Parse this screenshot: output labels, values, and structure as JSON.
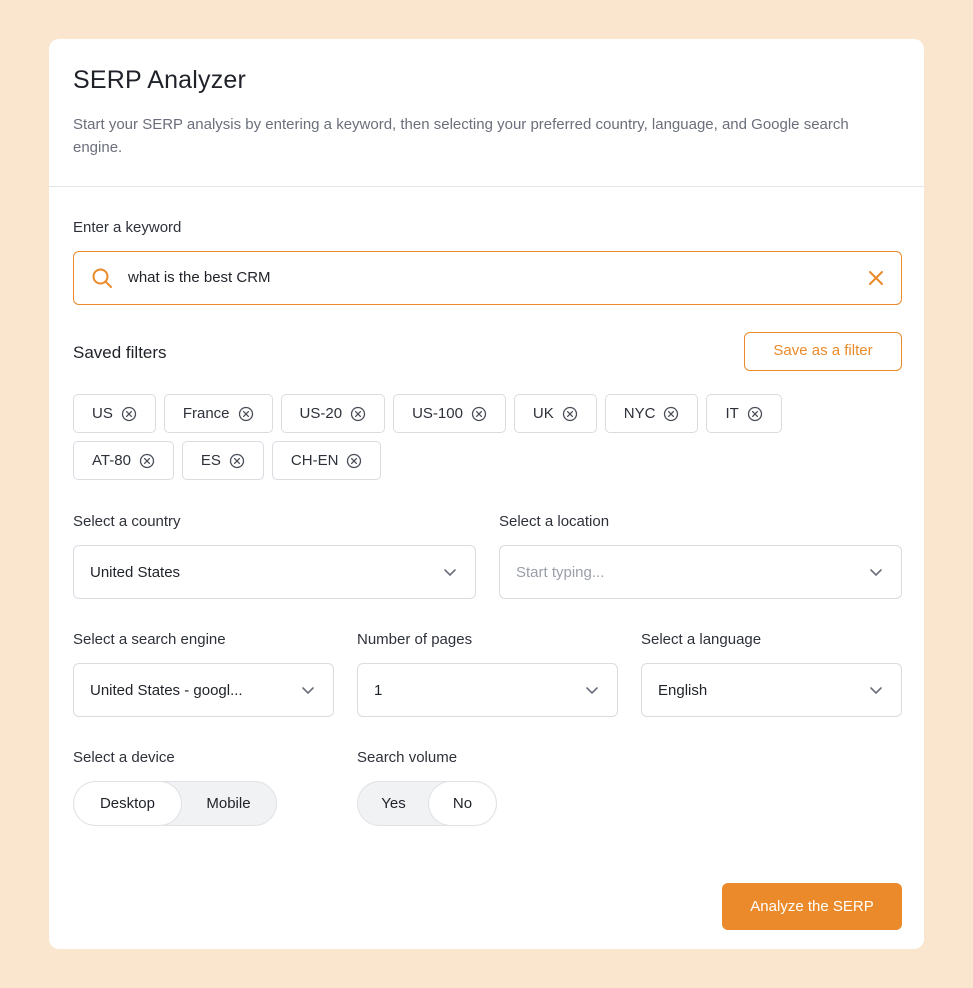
{
  "header": {
    "title": "SERP Analyzer",
    "subtitle": "Start your SERP analysis by entering a keyword, then selecting your preferred country, language, and Google search engine."
  },
  "keyword": {
    "label": "Enter a keyword",
    "value": "what is the best CRM",
    "icon": "search-icon",
    "clear_icon": "close-icon"
  },
  "filters": {
    "title": "Saved filters",
    "save_button": "Save as a filter",
    "row1": [
      "US",
      "France",
      "US-20",
      "US-100",
      "UK",
      "NYC",
      "IT"
    ],
    "row2": [
      "AT-80",
      "ES",
      "CH-EN"
    ]
  },
  "country": {
    "label": "Select a country",
    "value": "United States"
  },
  "location": {
    "label": "Select a location",
    "placeholder": "Start typing..."
  },
  "engine": {
    "label": "Select a search engine",
    "value": "United States - googl..."
  },
  "pages": {
    "label": "Number of pages",
    "value": "1"
  },
  "language": {
    "label": "Select a language",
    "value": "English"
  },
  "device": {
    "label": "Select a device",
    "options": [
      "Desktop",
      "Mobile"
    ],
    "selected": "Desktop"
  },
  "volume": {
    "label": "Search volume",
    "options": [
      "Yes",
      "No"
    ],
    "selected": "No"
  },
  "analyze_button": "Analyze the SERP",
  "colors": {
    "accent": "#ea8a2a",
    "background": "#fae6cf",
    "card": "#ffffff"
  }
}
